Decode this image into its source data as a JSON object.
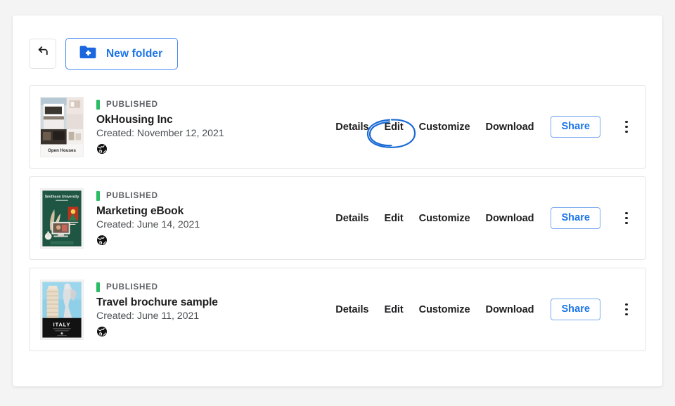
{
  "toolbar": {
    "back_label": "back-arrow",
    "new_folder_label": "New folder",
    "folder_icon": "folder-plus-icon",
    "accent_color": "#1a73e8"
  },
  "list": {
    "status_color": "#2bbc65",
    "items": [
      {
        "status": "PUBLISHED",
        "title": "OkHousing Inc",
        "date": "Created: November 12, 2021",
        "visibility_icon": "globe-icon",
        "thumbnail": "open-houses-thumbnail",
        "thumbnail_caption": "Open Houses",
        "actions": [
          "Details",
          "Edit",
          "Customize",
          "Download"
        ],
        "share_label": "Share",
        "menu_icon": "kebab-menu-icon",
        "annotated_action": "Edit"
      },
      {
        "status": "PUBLISHED",
        "title": "Marketing eBook",
        "date": "Created: June 14, 2021",
        "visibility_icon": "globe-icon",
        "thumbnail": "marketing-ebook-thumbnail",
        "thumbnail_caption": "Smithson University",
        "actions": [
          "Details",
          "Edit",
          "Customize",
          "Download"
        ],
        "share_label": "Share",
        "menu_icon": "kebab-menu-icon",
        "annotated_action": ""
      },
      {
        "status": "PUBLISHED",
        "title": "Travel brochure sample",
        "date": "Created: June 11, 2021",
        "visibility_icon": "globe-icon",
        "thumbnail": "italy-travel-thumbnail",
        "thumbnail_caption": "ITALY",
        "actions": [
          "Details",
          "Edit",
          "Customize",
          "Download"
        ],
        "share_label": "Share",
        "menu_icon": "kebab-menu-icon",
        "annotated_action": ""
      }
    ]
  },
  "annotation": {
    "shape": "hand-drawn-ellipse",
    "color": "#1a6ad4",
    "targets": "Edit"
  }
}
